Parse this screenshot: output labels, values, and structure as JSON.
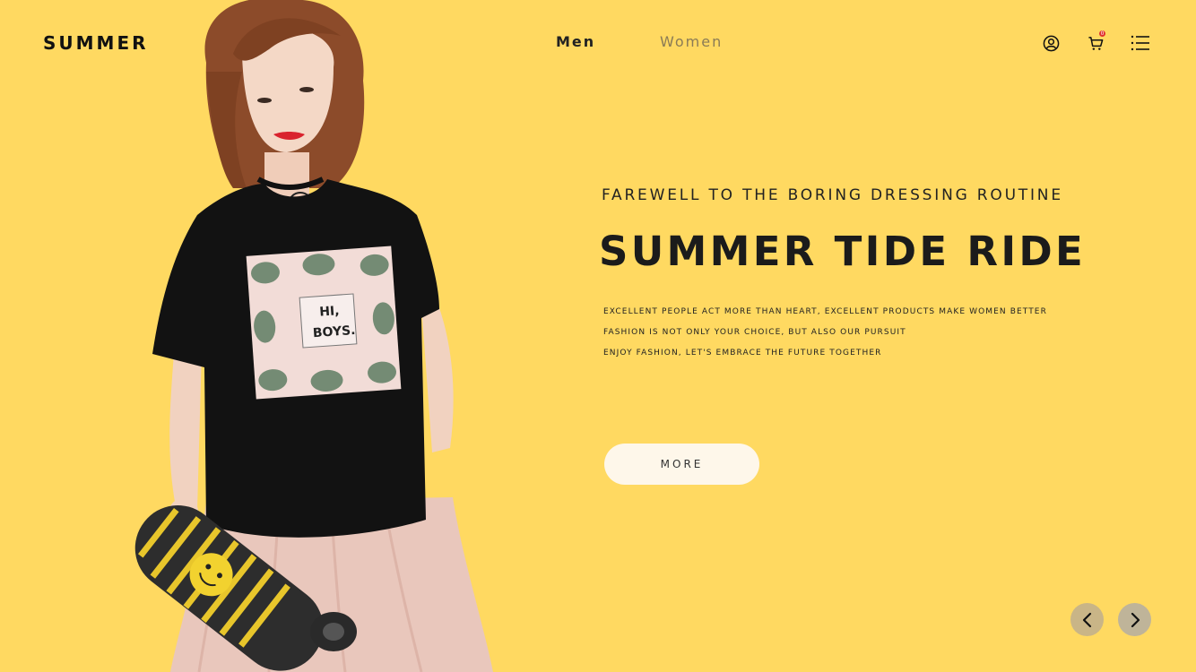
{
  "header": {
    "logo": "SUMMER",
    "nav": [
      {
        "label": "Men"
      },
      {
        "label": "Women"
      }
    ],
    "icons": [
      "user-icon",
      "cart-icon",
      "menu-icon"
    ],
    "cart_count": "0"
  },
  "hero": {
    "subtitle": "FAREWELL TO THE BORING DRESSING ROUTINE",
    "headline": "SUMMER TIDE RIDE",
    "lines": [
      "EXCELLENT PEOPLE ACT MORE THAN HEART, EXCELLENT PRODUCTS MAKE WOMEN BETTER",
      "FASHION IS NOT ONLY YOUR CHOICE, BUT ALSO OUR PURSUIT",
      "ENJOY FASHION, LET'S EMBRACE THE FUTURE TOGETHER"
    ],
    "cta_label": "MORE",
    "tshirt_print": [
      "HI,",
      "BOYS."
    ]
  },
  "slider": {
    "prev_icon": "chevron-left-icon",
    "next_icon": "chevron-right-icon"
  },
  "colors": {
    "background": "#FFD961",
    "button_bg": "#FEF7EA",
    "arrow_bg": "#C9B587",
    "badge": "#E0322F"
  }
}
